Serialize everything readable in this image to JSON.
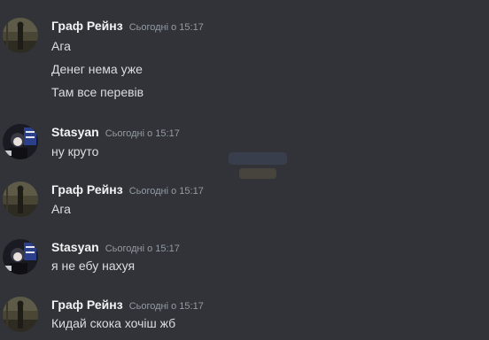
{
  "messages": [
    {
      "author": "Граф Рейнз",
      "timestamp": "Сьогодні о 15:17",
      "avatar_icon": "dark-outdoor-figure-avatar",
      "lines": [
        "Ага",
        "Денег нема уже",
        "Там все перевів"
      ]
    },
    {
      "author": "Stasyan",
      "timestamp": "Сьогодні о 15:17",
      "avatar_icon": "person-with-flag-avatar",
      "lines": [
        "ну круто"
      ]
    },
    {
      "author": "Граф Рейнз",
      "timestamp": "Сьогодні о 15:17",
      "avatar_icon": "dark-outdoor-figure-avatar",
      "lines": [
        "Ага"
      ]
    },
    {
      "author": "Stasyan",
      "timestamp": "Сьогодні о 15:17",
      "avatar_icon": "person-with-flag-avatar",
      "lines": [
        "я не ебу нахуя"
      ]
    },
    {
      "author": "Граф Рейнз",
      "timestamp": "Сьогодні о 15:17",
      "avatar_icon": "dark-outdoor-figure-avatar",
      "lines": [
        "Кидай скока хочіш жб"
      ]
    }
  ],
  "colors": {
    "background": "#313338",
    "author": "#f2f3f5",
    "timestamp": "#949ba4",
    "message_text": "#dbdee1"
  }
}
